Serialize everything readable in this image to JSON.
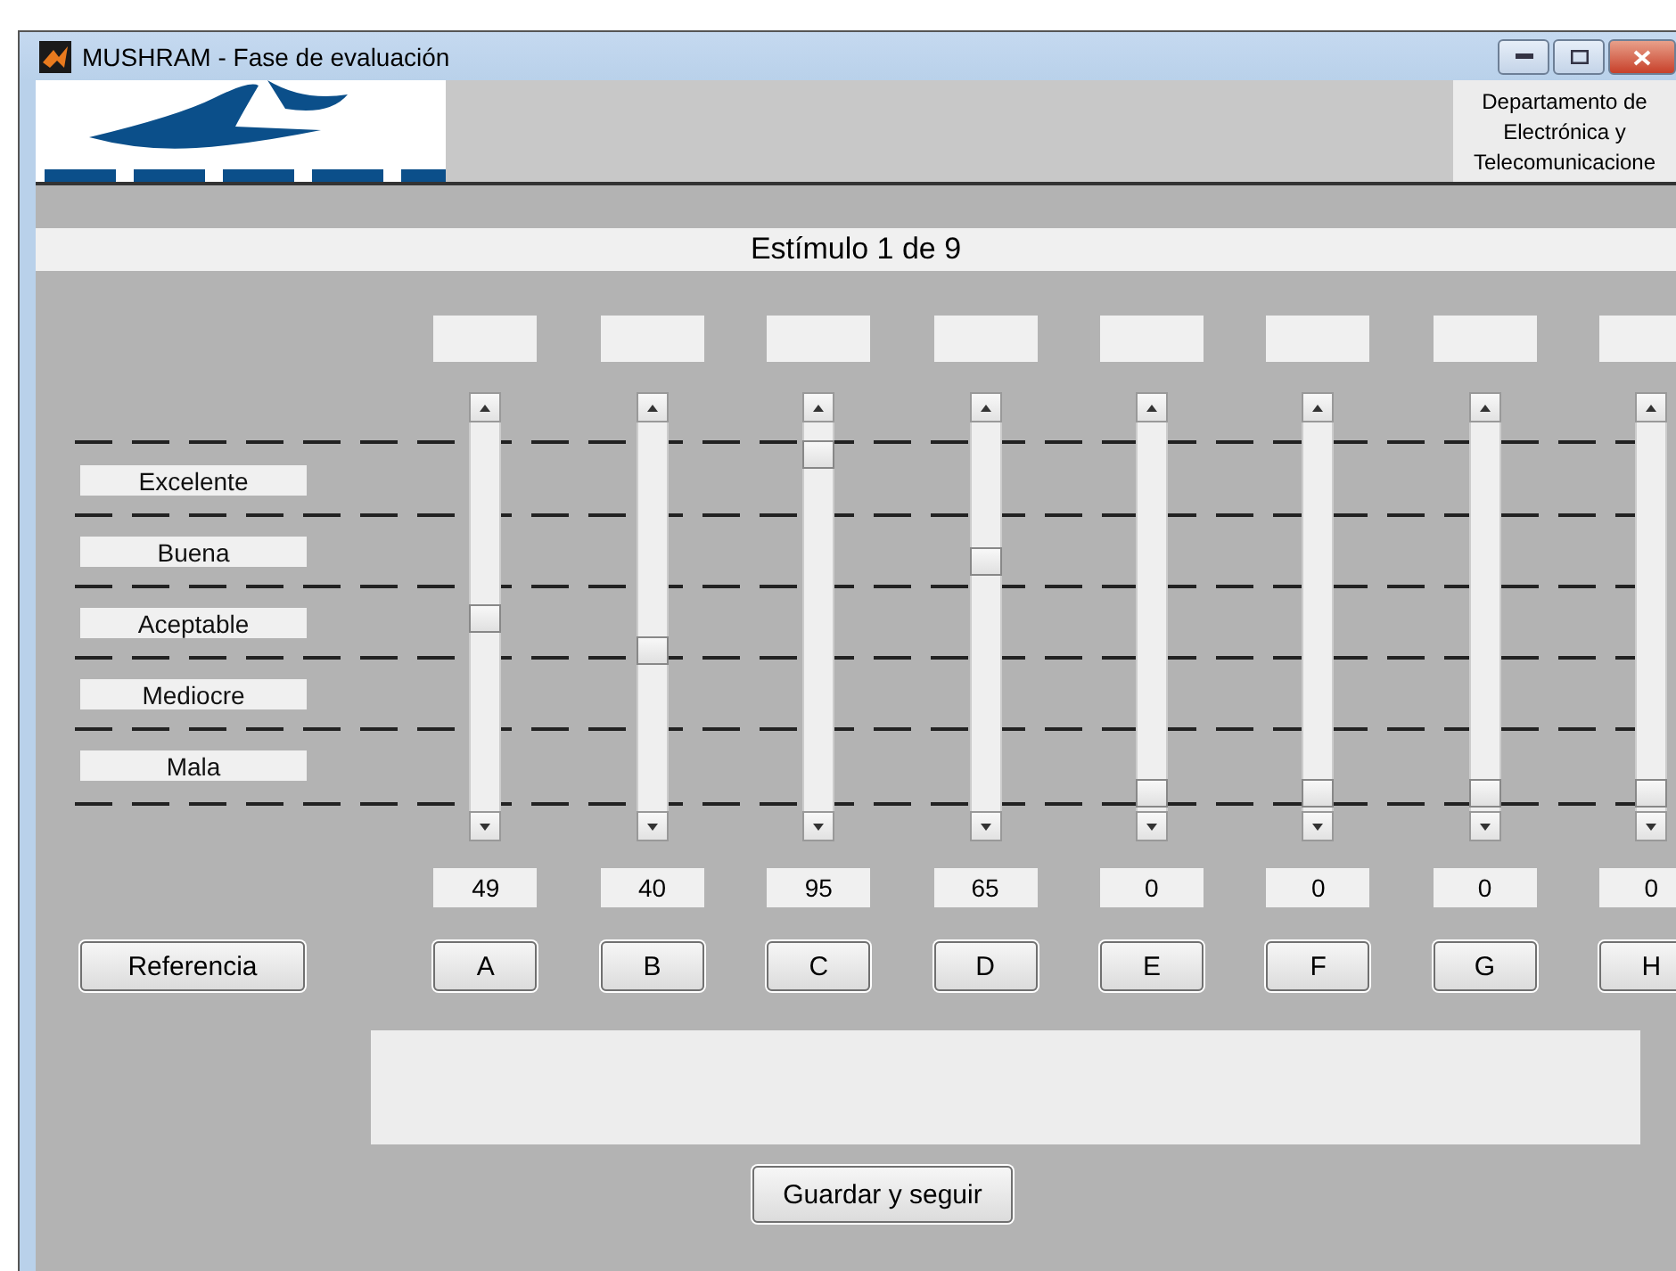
{
  "window": {
    "title": "MUSHRAM - Fase de evaluación"
  },
  "header": {
    "department": [
      "Departamento de",
      "Electrónica y",
      "Telecomunicacione"
    ]
  },
  "heading": "Estímulo 1 de 9",
  "scale_labels": [
    "Excelente",
    "Buena",
    "Aceptable",
    "Mediocre",
    "Mala"
  ],
  "sliders": [
    {
      "level": 0.49,
      "reading": "49",
      "button": "A"
    },
    {
      "level": 0.4,
      "reading": "40",
      "button": "B"
    },
    {
      "level": 0.95,
      "reading": "95",
      "button": "C"
    },
    {
      "level": 0.65,
      "reading": "65",
      "button": "D"
    },
    {
      "level": 0,
      "reading": "0",
      "button": "E"
    },
    {
      "level": 0,
      "reading": "0",
      "button": "F"
    },
    {
      "level": 0,
      "reading": "0",
      "button": "G"
    },
    {
      "level": 0,
      "reading": "0",
      "button": "H"
    }
  ],
  "reference_button": "Referencia",
  "save_button": "Guardar y seguir"
}
